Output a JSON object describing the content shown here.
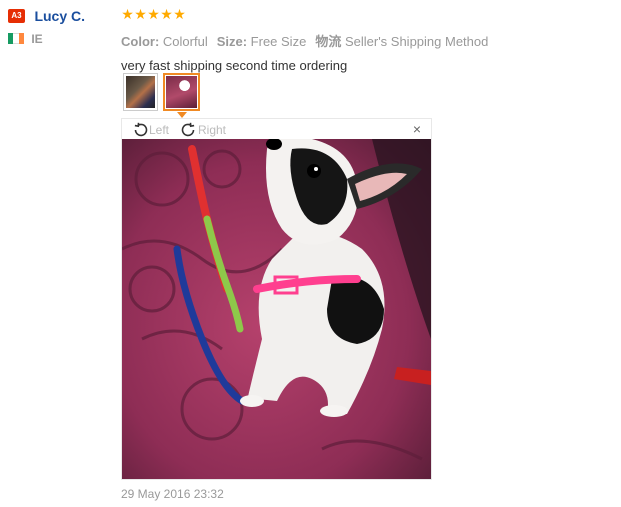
{
  "user": {
    "level_badge": "A3",
    "name": "Lucy C.",
    "country_code": "IE"
  },
  "review": {
    "rating": 5,
    "rating_max": 5,
    "star_glyph": "★",
    "star_color": "#ffaa00",
    "attributes": [
      {
        "key": "Color:",
        "value": "Colorful"
      },
      {
        "key": "Size:",
        "value": "Free Size"
      },
      {
        "key": "物流",
        "value": "Seller's Shipping Method"
      }
    ],
    "text": "very fast shipping second time ordering",
    "timestamp": "29 May 2016 23:32"
  },
  "viewer": {
    "rotate_left_label": "Left",
    "rotate_right_label": "Right",
    "close_glyph": "×",
    "selected_thumb_index": 1
  },
  "icons": {
    "rotate_left": "rotate-left-icon",
    "rotate_right": "rotate-right-icon",
    "close": "close-icon",
    "flag": "ireland-flag-icon"
  },
  "colors": {
    "username": "#1a4e9e",
    "badge": "#e62e04",
    "selected_thumb_border": "#f08a24"
  }
}
